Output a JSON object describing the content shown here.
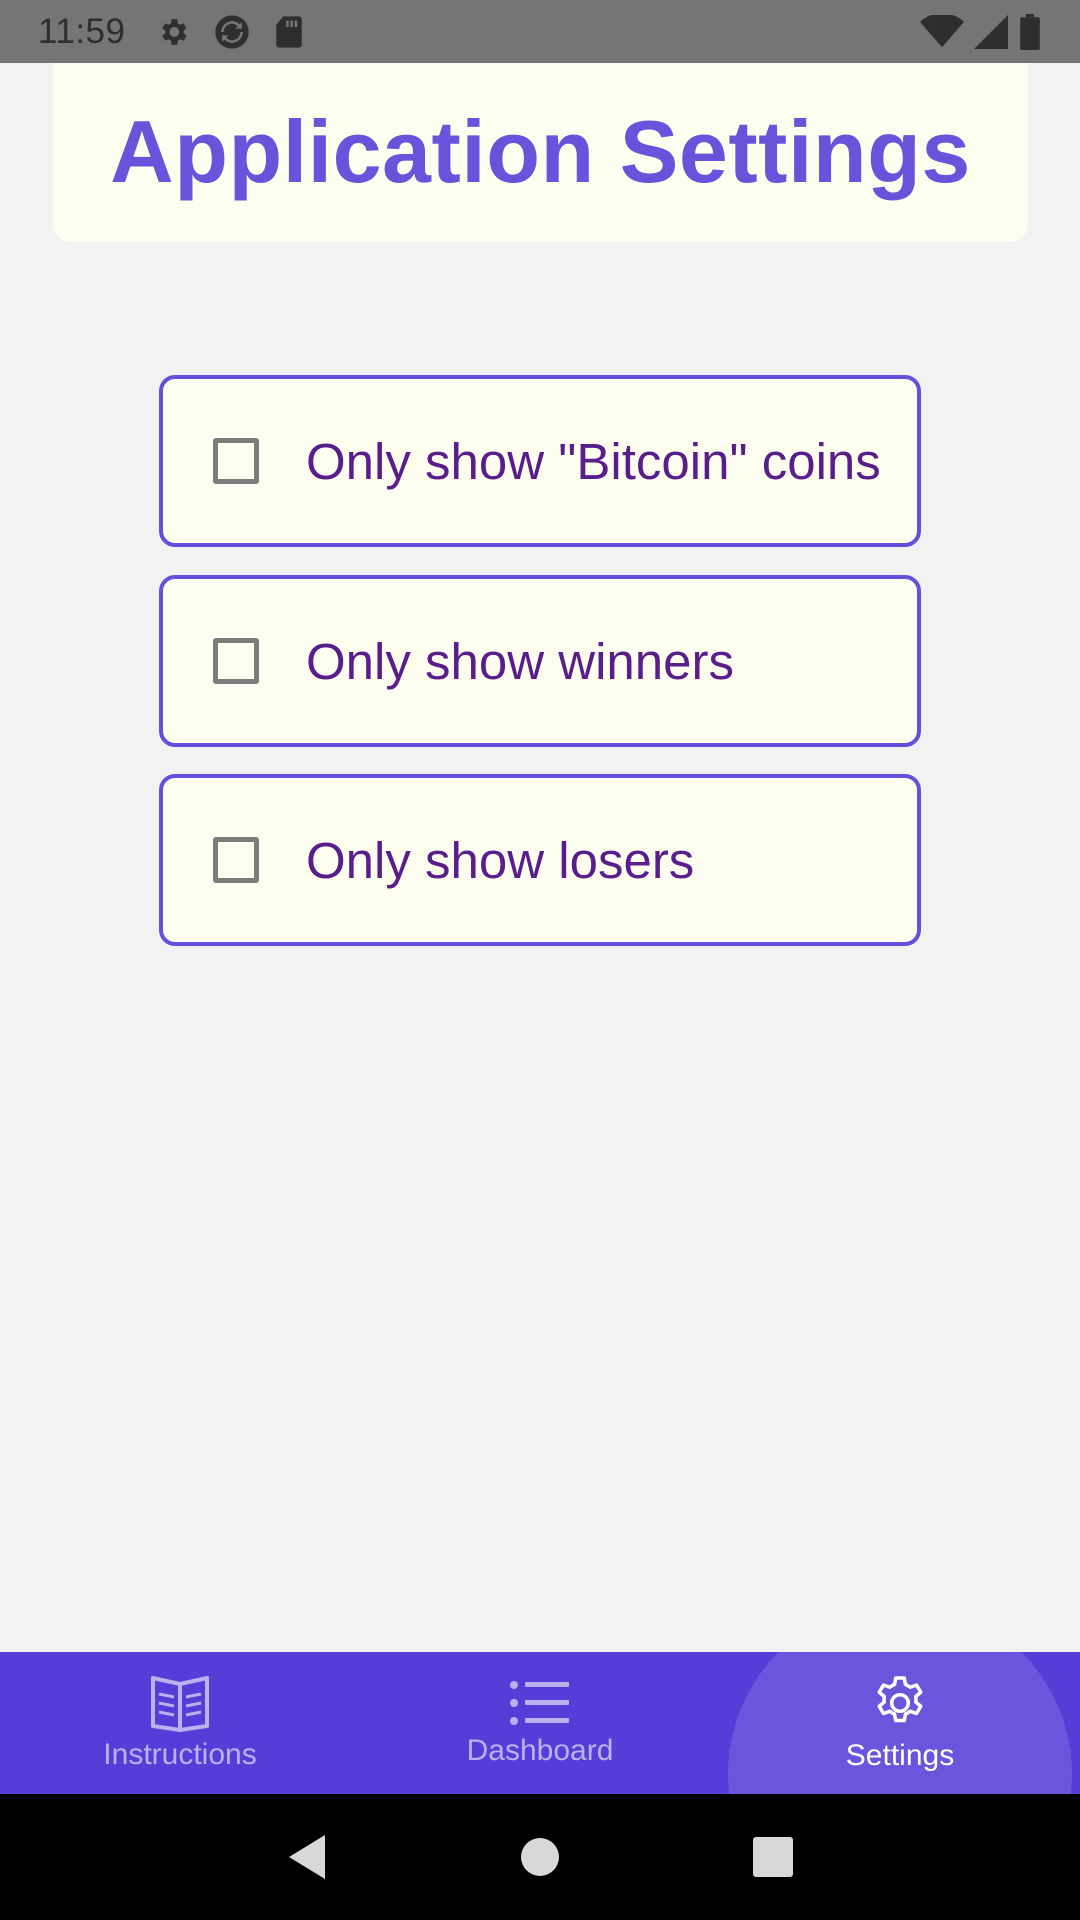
{
  "status_bar": {
    "time": "11:59",
    "left_icons": [
      "settings-icon",
      "sync-icon",
      "sd-card-icon"
    ],
    "right_icons": [
      "wifi-icon",
      "signal-icon",
      "battery-icon"
    ]
  },
  "header": {
    "title": "Application Settings"
  },
  "options": [
    {
      "label": "Only show \"Bitcoin\" coins",
      "checked": false
    },
    {
      "label": "Only show winners",
      "checked": false
    },
    {
      "label": "Only show losers",
      "checked": false
    }
  ],
  "bottom_nav": {
    "items": [
      {
        "label": "Instructions",
        "icon": "book-icon",
        "active": false
      },
      {
        "label": "Dashboard",
        "icon": "list-icon",
        "active": false
      },
      {
        "label": "Settings",
        "icon": "gear-icon",
        "active": true
      }
    ]
  },
  "system_nav": {
    "buttons": [
      "back-icon",
      "home-icon",
      "recents-icon"
    ]
  },
  "colors": {
    "accent": "#6450dc",
    "title": "#6a52da",
    "option_text": "#5a1e8c",
    "nav_background": "#543ed7",
    "card_background": "#fefef0",
    "page_background": "#f2f2f3"
  }
}
